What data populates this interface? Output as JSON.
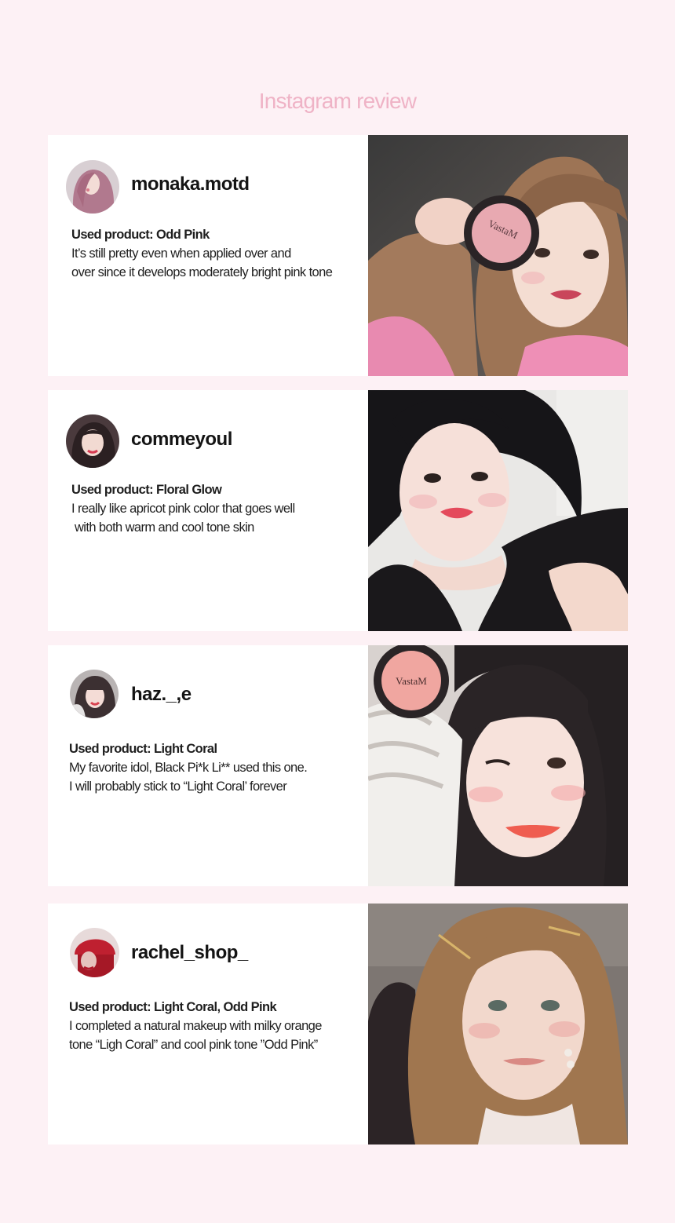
{
  "page": {
    "title": "Instagram review"
  },
  "reviews": [
    {
      "username": "monaka.motd",
      "product": "Used product: Odd Pink",
      "lines": [
        "It’s still pretty even when applied over and",
        "over since it develops moderately bright pink tone"
      ],
      "avatar_icon": "avatar-woman-pink-hair",
      "photo_icon": "selfie-with-blush-compact",
      "photo_text": "VastaM"
    },
    {
      "username": "commeyoul",
      "product": "Used product: Floral Glow",
      "lines": [
        "I really like apricot pink color that goes well",
        " with both warm and cool tone skin"
      ],
      "avatar_icon": "avatar-woman-dark-hair",
      "photo_icon": "selfie-short-black-hair"
    },
    {
      "username": "haz._,e",
      "product": "Used product: Light Coral",
      "lines": [
        "My favorite idol, Black Pi*k Li** used this one.",
        "I will probably stick to “Light Coral’ forever"
      ],
      "avatar_icon": "avatar-woman-bangs",
      "photo_icon": "selfie-wink-with-compact",
      "photo_text": "VastaM"
    },
    {
      "username": "rachel_shop_",
      "product": "Used product: Light Coral, Odd Pink",
      "lines": [
        "I completed a natural makeup with milky orange",
        "tone “Ligh Coral” and cool pink tone ”Odd Pink”"
      ],
      "avatar_icon": "avatar-red-beanie",
      "photo_icon": "portrait-wavy-hair-hairpins"
    }
  ],
  "colors": {
    "background": "#fdf1f5",
    "title": "#efb3c6",
    "card": "#ffffff"
  }
}
